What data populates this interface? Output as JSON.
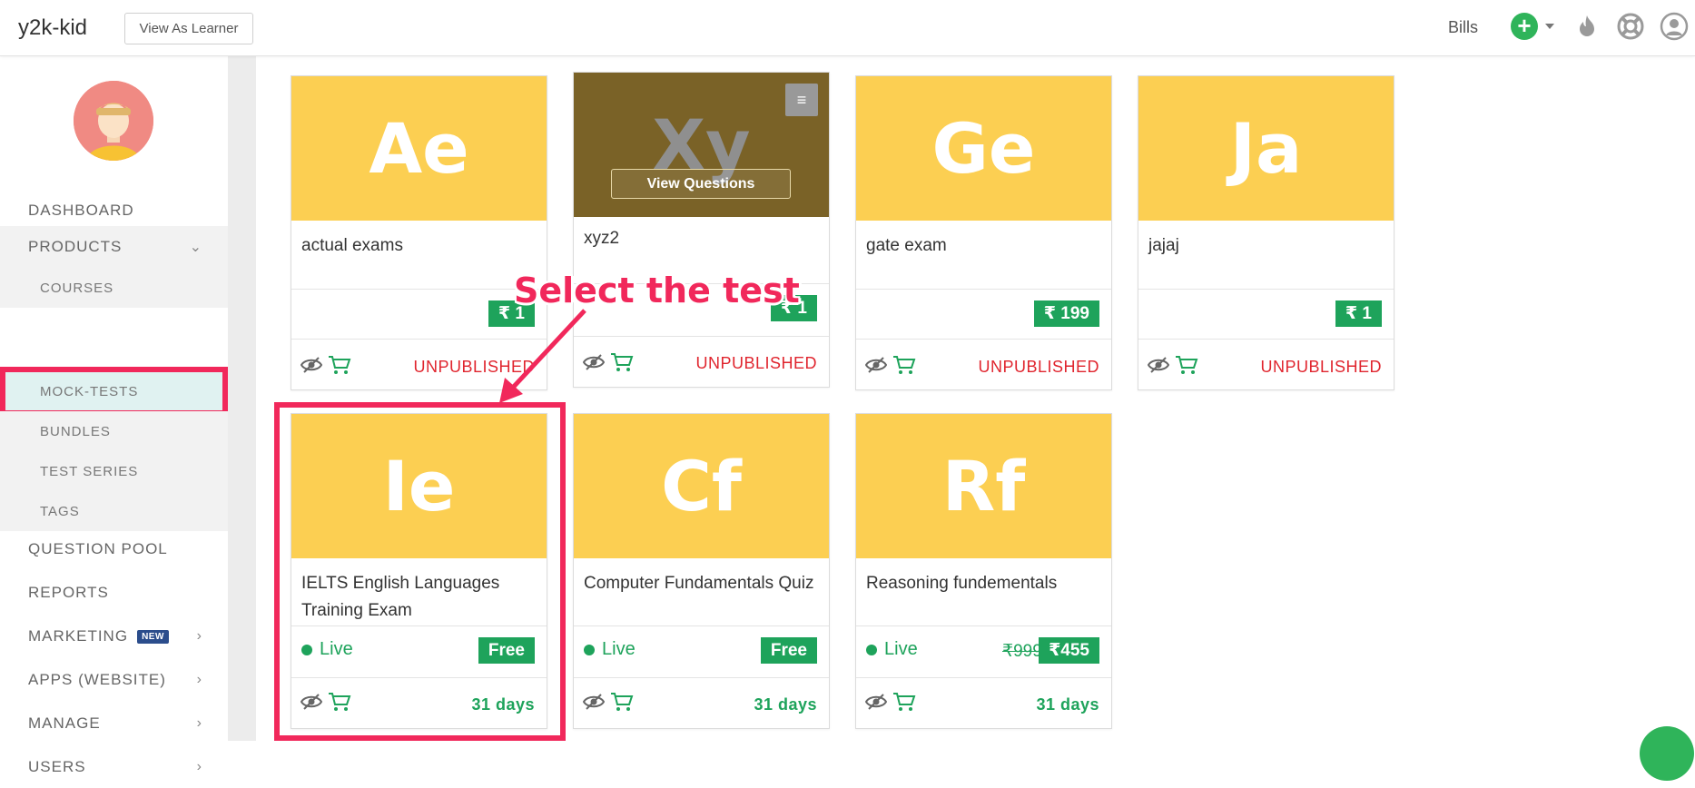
{
  "header": {
    "brand": "y2k-kid",
    "view_as_learner": "View As Learner",
    "bills": "Bills",
    "plus_symbol": "+",
    "icons": [
      "fire-icon",
      "lifebuoy-icon",
      "user-account-icon"
    ]
  },
  "sidebar": {
    "dashboard": "DASHBOARD",
    "products": "PRODUCTS",
    "sub_items": {
      "courses": "COURSES",
      "mock_tests": "MOCK-TESTS",
      "bundles": "BUNDLES",
      "test_series": "TEST SERIES",
      "tags": "TAGS"
    },
    "question_pool": "QUESTION POOL",
    "reports": "REPORTS",
    "marketing": "MARKETING",
    "new_badge": "NEW",
    "apps": "APPS (WEBSITE)",
    "manage": "MANAGE",
    "users": "USERS",
    "active_item": "MOCK-TESTS"
  },
  "annotation": {
    "text": "Select the test",
    "color": "#f1285b"
  },
  "cards": {
    "c1": {
      "initials": "Ae",
      "title": "actual exams",
      "price": "₹ 1",
      "status": "UNPUBLISHED"
    },
    "c2": {
      "initials": "Xy",
      "title": "xyz2",
      "price": "₹ 1",
      "status": "UNPUBLISHED",
      "menu_icon": "≡",
      "view_questions": "View Questions"
    },
    "c3": {
      "initials": "Ge",
      "title": "gate exam",
      "price": "₹ 199",
      "status": "UNPUBLISHED"
    },
    "c4": {
      "initials": "Ja",
      "title": "jajaj",
      "price": "₹ 1",
      "status": "UNPUBLISHED"
    },
    "c5": {
      "initials": "Ie",
      "title": "IELTS English Languages Training Exam",
      "live": "Live",
      "price": "Free",
      "validity": "31 days"
    },
    "c6": {
      "initials": "Cf",
      "title": "Computer Fundamentals Quiz",
      "live": "Live",
      "price": "Free",
      "validity": "31 days"
    },
    "c7": {
      "initials": "Rf",
      "title": "Reasoning fundementals",
      "live": "Live",
      "original_price": "₹999",
      "price": "₹455",
      "validity": "31 days"
    }
  },
  "colors": {
    "thumb_yellow": "#fccf52",
    "price_green": "#1ea35b",
    "unpublished_red": "#e0252e",
    "highlight_pink": "#f1285b"
  }
}
